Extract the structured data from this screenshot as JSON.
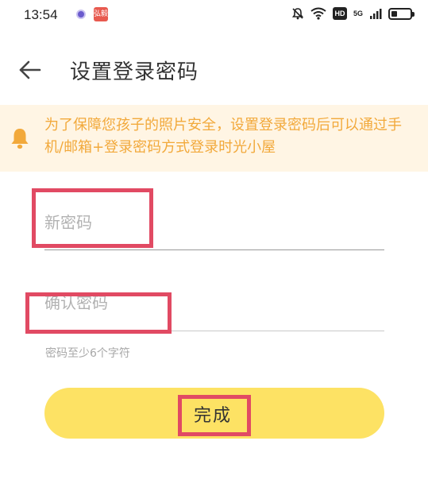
{
  "status_bar": {
    "time": "13:54",
    "app_badge_text": "弘毅",
    "hd_label": "HD",
    "network_label": "5G",
    "battery_level": 0.3,
    "icons": [
      "mute-bell-icon",
      "wifi-icon",
      "signal-icon",
      "battery-icon"
    ]
  },
  "header": {
    "title": "设置登录密码",
    "back_icon": "back-arrow-icon"
  },
  "notice": {
    "icon": "bell-icon",
    "text": "为了保障您孩子的照片安全，设置登录密码后可以通过手机/邮箱+登录密码方式登录时光小屋",
    "color": "#f2a93b",
    "background": "#fff5e4"
  },
  "form": {
    "new_password": {
      "value": "",
      "placeholder": "新密码"
    },
    "confirm_password": {
      "value": "",
      "placeholder": "确认密码"
    },
    "hint": "密码至少6个字符"
  },
  "submit": {
    "label": "完成",
    "color": "#fde264"
  },
  "highlight_color": "#e14a63"
}
